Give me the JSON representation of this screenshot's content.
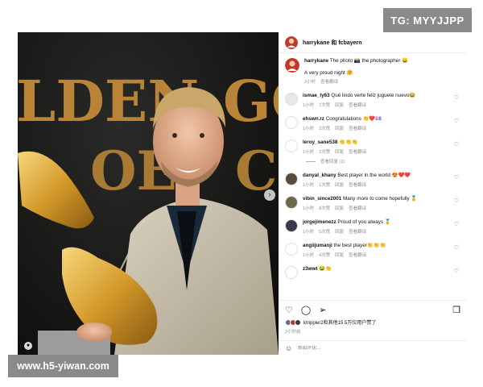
{
  "watermarks": {
    "top_right": "TG: MYYJJPP",
    "bottom_left": "www.h5-yiwan.com"
  },
  "photo": {
    "bg_text_top": "LDEN",
    "bg_text_right": "GOL",
    "bg_text_mid": "OE",
    "bg_text_c": "C"
  },
  "header": {
    "title": "harrykane 和 fcbayern"
  },
  "caption": {
    "user": "harrykane",
    "text": "The photo 📸 the photographer 😄",
    "line2": "A very proud night 🤗",
    "time": "2小时",
    "translate": "查看翻译"
  },
  "comments": [
    {
      "user": "ismae_ly63",
      "text": "Qué lindo verte feliz juguete nuevo😂",
      "time": "1小时",
      "likes": "7次赞",
      "reply": "回复",
      "translate": "查看翻译",
      "avatar_color": "#e8e8e8"
    },
    {
      "user": "ehswn.rz",
      "text": "Congratulations 👏❤️💷",
      "time": "1小时",
      "likes": "3次赞",
      "reply": "回复",
      "translate": "查看翻译",
      "avatar_color": "#ffffff"
    },
    {
      "user": "leroy_sane538",
      "text": "👏👏👏",
      "time": "1小时",
      "likes": "2次赞",
      "reply": "回复",
      "translate": "查看翻译",
      "avatar_color": "#ffffff",
      "replies_label": "查看回复 (1)"
    },
    {
      "user": "danyal_khany",
      "text": "Best player in the world 😍❤️❤️",
      "time": "1小时",
      "likes": "1次赞",
      "reply": "回复",
      "translate": "查看翻译",
      "avatar_color": "#5b4a3a"
    },
    {
      "user": "vibin_since2001",
      "text": "Many more to come hopefully 🏅",
      "time": "1小时",
      "likes": "8次赞",
      "reply": "回复",
      "translate": "查看翻译",
      "avatar_color": "#6b6b4a"
    },
    {
      "user": "jorgejimenezz",
      "text": "Proud of you always 🏅",
      "time": "1小时",
      "likes": "5次赞",
      "reply": "回复",
      "translate": "查看翻译",
      "avatar_color": "#3a3a4a"
    },
    {
      "user": "angiijumanji",
      "text": "the best player👏👏👏",
      "time": "1小时",
      "likes": "4次赞",
      "reply": "回复",
      "translate": "查看翻译",
      "avatar_color": "#ffffff"
    },
    {
      "user": "z3wwt",
      "text": "😂👏",
      "time": "",
      "likes": "",
      "reply": "",
      "translate": "",
      "avatar_color": "#ffffff"
    }
  ],
  "actions": {
    "like_icon": "heart-icon",
    "comment_icon": "comment-icon",
    "share_icon": "send-icon",
    "save_icon": "bookmark-icon"
  },
  "likes": {
    "text": "ktrippier2和其他15.5万位用户赞了",
    "time": "2小时前"
  },
  "add_comment": {
    "placeholder": "添加评论..."
  }
}
